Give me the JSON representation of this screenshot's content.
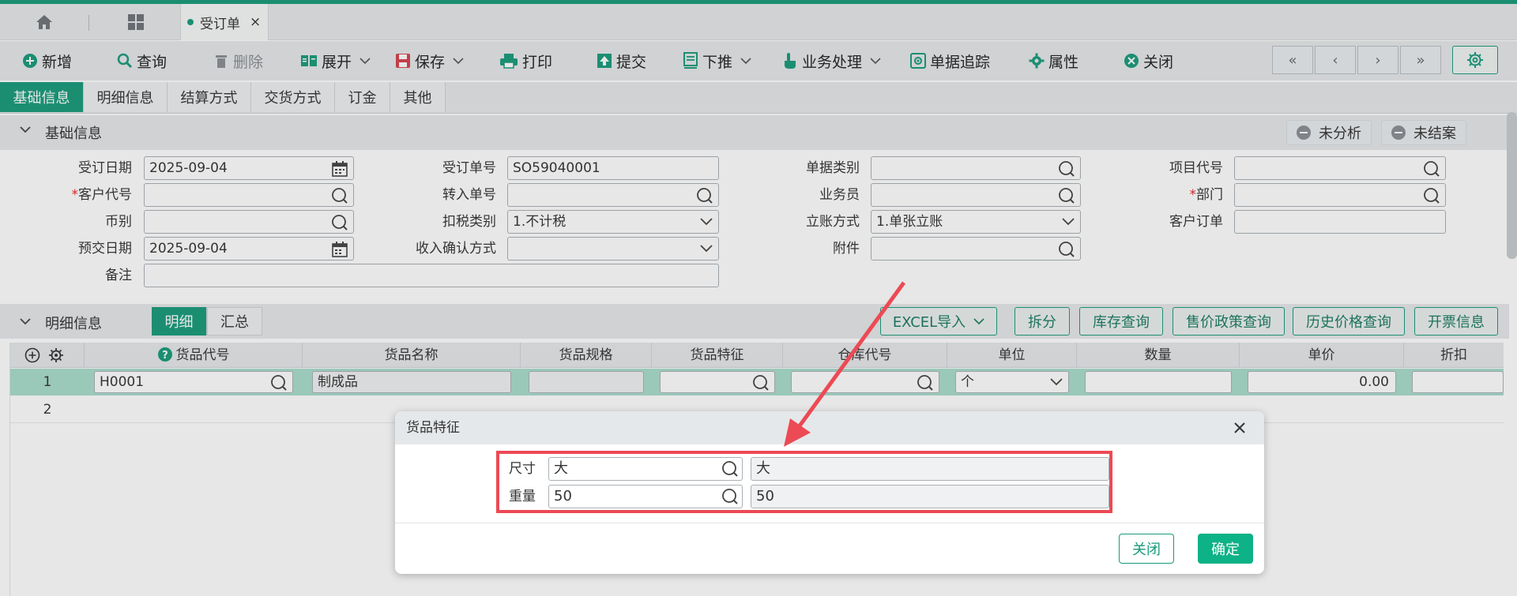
{
  "tabbar": {
    "doc_tab": "受订单",
    "close": "×"
  },
  "toolbar": {
    "add": "新增",
    "query": "查询",
    "delete": "删除",
    "expand": "展开",
    "save": "保存",
    "print": "打印",
    "submit": "提交",
    "push_down": "下推",
    "business": "业务处理",
    "trace": "单据追踪",
    "props": "属性",
    "close": "关闭"
  },
  "nav": {
    "first": "«",
    "prev": "‹",
    "next": "›",
    "last": "»"
  },
  "subtabs": [
    "基础信息",
    "明细信息",
    "结算方式",
    "交货方式",
    "订金",
    "其他"
  ],
  "basic": {
    "title": "基础信息",
    "status1": "未分析",
    "status2": "未结案",
    "labels": {
      "order_date": "受订日期",
      "customer": "客户代号",
      "currency": "币别",
      "due_date": "预交日期",
      "remark": "备注",
      "order_no": "受订单号",
      "transfer_no": "转入单号",
      "tax_type": "扣税类别",
      "income_confirm": "收入确认方式",
      "doc_type": "单据类别",
      "salesman": "业务员",
      "account_mode": "立账方式",
      "attachment": "附件",
      "project": "项目代号",
      "department": "部门",
      "cust_order": "客户订单"
    },
    "values": {
      "order_date": "2025-09-04",
      "due_date": "2025-09-04",
      "order_no": "SO59040001",
      "tax_type": "1.不计税",
      "account_mode": "1.单张立账"
    },
    "required_mark": "*"
  },
  "detail": {
    "title": "明细信息",
    "tab_detail": "明细",
    "tab_summary": "汇总",
    "buttons": {
      "excel": "EXCEL导入",
      "split": "拆分",
      "stock": "库存查询",
      "policy": "售价政策查询",
      "history": "历史价格查询",
      "invoice": "开票信息"
    },
    "columns": [
      "货品代号",
      "货品名称",
      "货品规格",
      "货品特征",
      "仓库代号",
      "单位",
      "数量",
      "单价",
      "折扣"
    ],
    "rows": [
      {
        "no": "1",
        "code": "H0001",
        "name": "制成品",
        "unit": "个",
        "price": "0.00"
      },
      {
        "no": "2"
      }
    ]
  },
  "dialog": {
    "title": "货品特征",
    "rows": [
      {
        "label": "尺寸",
        "value": "大",
        "display": "大"
      },
      {
        "label": "重量",
        "value": "50",
        "display": "50"
      }
    ],
    "cancel": "关闭",
    "ok": "确定"
  }
}
